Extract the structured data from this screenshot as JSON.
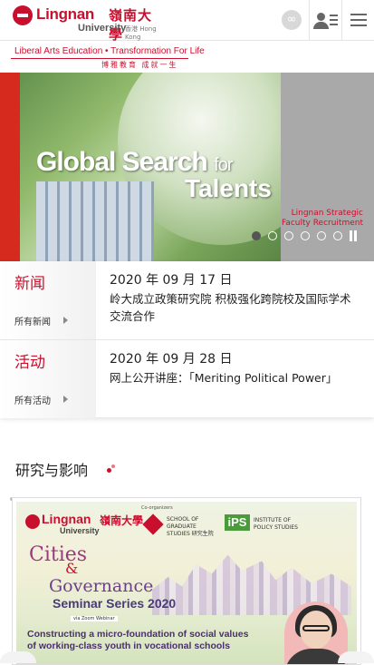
{
  "header": {
    "logo_en": "Lingnan",
    "logo_zh": "嶺南大學",
    "logo_university": "University",
    "logo_hk": "香港 Hong Kong",
    "link_icon": "link-icon",
    "people_icon": "people-list-icon",
    "menu_icon": "hamburger-menu-icon"
  },
  "tagline": {
    "en": "Liberal Arts Education • Transformation For Life",
    "zh": "博雅教育 成就一生"
  },
  "banner": {
    "title_main": "Global Search ",
    "title_for": "for",
    "title_second": "Talents",
    "subtitle_1": "Lingnan Strategic",
    "subtitle_2": "Faculty Recruitment",
    "slides_total": 6,
    "active_slide": 1,
    "pause_icon": "pause-icon"
  },
  "news": {
    "category": "新闻",
    "all_link": "所有新闻",
    "date": "2020 年 09 月 17 日",
    "text": "岭大成立政策研究院 积极强化跨院校及国际学术交流合作"
  },
  "events": {
    "category": "活动",
    "all_link": "所有活动",
    "date": "2020 年 09 月 28 日",
    "text": "网上公开讲座：「Meriting Political Power」"
  },
  "research": {
    "section_title": "研究与影响",
    "card": {
      "logo_en": "Lingnan",
      "logo_zh": "嶺南大學",
      "logo_university": "University",
      "co_label": "Co-organizers",
      "sgs": "SCHOOL OF GRADUATE STUDIES 研究生院",
      "ips_mark": "iPS",
      "ips": "INSTITUTE OF POLICY STUDIES",
      "cities": "Cities",
      "amp": "&",
      "governance": "Governance",
      "series": "Seminar Series 2020",
      "via": "via Zoom Webinar",
      "description": "Constructing a micro-foundation of social values of working-class youth in vocational schools"
    }
  }
}
